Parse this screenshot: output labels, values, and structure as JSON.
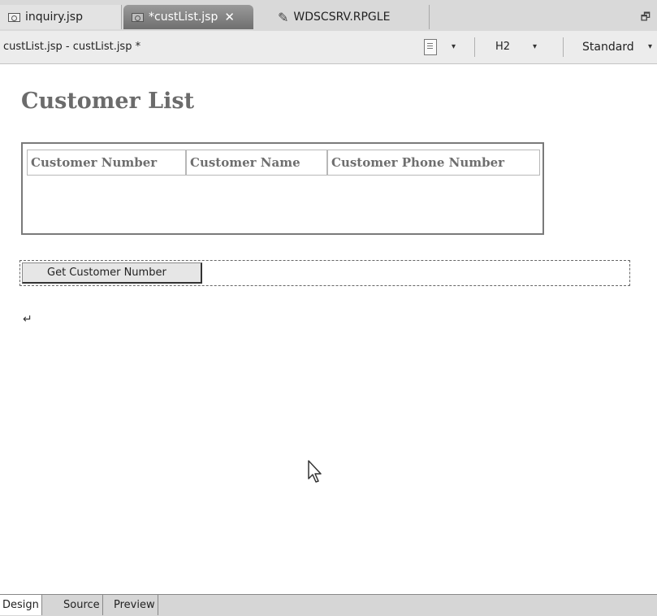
{
  "tabs": [
    {
      "label": "inquiry.jsp"
    },
    {
      "label": "*custList.jsp"
    },
    {
      "label": "WDSCSRV.RPGLE"
    }
  ],
  "toolbar": {
    "editor_title": "custList.jsp - custList.jsp *",
    "heading_style": "H2",
    "font_style": "Standard"
  },
  "canvas": {
    "heading": "Customer List",
    "table_headers": [
      "Customer Number",
      "Customer Name",
      "Customer Phone Number"
    ],
    "submit_button_label": "Get Customer Number",
    "return_mark": "↵"
  },
  "view_tabs": [
    {
      "label": "Design",
      "active": true
    },
    {
      "label": "Source",
      "active": false
    },
    {
      "label": "Preview",
      "active": false
    }
  ],
  "icons": {
    "close": "✕",
    "dropdown": "▾",
    "restore": "🗗"
  }
}
